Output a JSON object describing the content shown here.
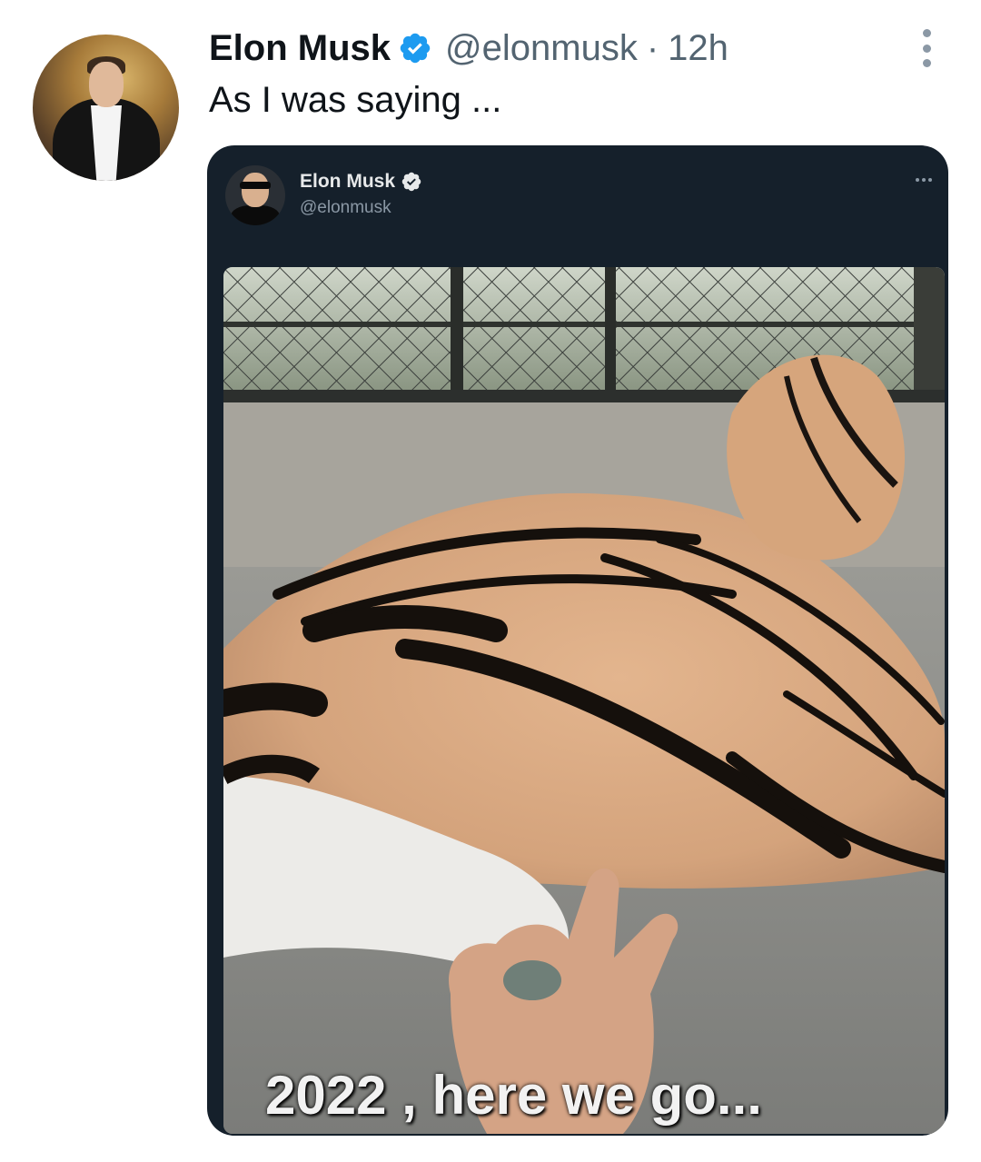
{
  "tweet": {
    "author_name": "Elon Musk",
    "handle": "@elonmusk",
    "separator": "·",
    "time": "12h",
    "text": "As I was saying ..."
  },
  "embedded_tweet": {
    "author_name": "Elon Musk",
    "handle": "@elonmusk",
    "meme_caption": "2022 , here we go..."
  },
  "icons": {
    "verified": "verified-badge-icon",
    "more": "more-options-icon"
  },
  "colors": {
    "verified_blue": "#1d9bf0",
    "embed_background": "#15202b"
  }
}
